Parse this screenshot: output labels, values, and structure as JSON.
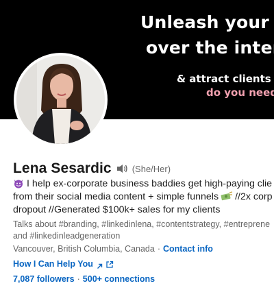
{
  "banner": {
    "line1": "Unleash your u",
    "line2": "over the intern",
    "line3": "& attract clients wh",
    "line4": "do you need"
  },
  "profile": {
    "name": "Lena Sesardic",
    "pronouns": "(She/Her)",
    "headline_line1": "I help ex-corporate business baddies get high-paying clie",
    "headline_line2a": "from their social media content + simple funnels",
    "headline_line2b": "//2x corp",
    "headline_line3": "dropout //Generated $100k+ sales for my clients",
    "talks_line1": "Talks about #branding, #linkedinlena, #contentstrategy, #entreprene",
    "talks_line2": "and #linkedinleadgeneration",
    "location": "Vancouver, British Columbia, Canada",
    "contact_info": "Contact info",
    "help_link": "How I Can Help You",
    "followers": "7,087 followers",
    "connections": "500+ connections"
  },
  "colors": {
    "banner_bg": "#000000",
    "accent_pink": "#f2a1b0",
    "link_blue": "#0a66c2",
    "muted_text": "#666666"
  },
  "icons": [
    "speaker-icon",
    "devil-emoji-icon",
    "money-emoji-icon",
    "arrow-up-right-icon",
    "external-link-icon"
  ]
}
